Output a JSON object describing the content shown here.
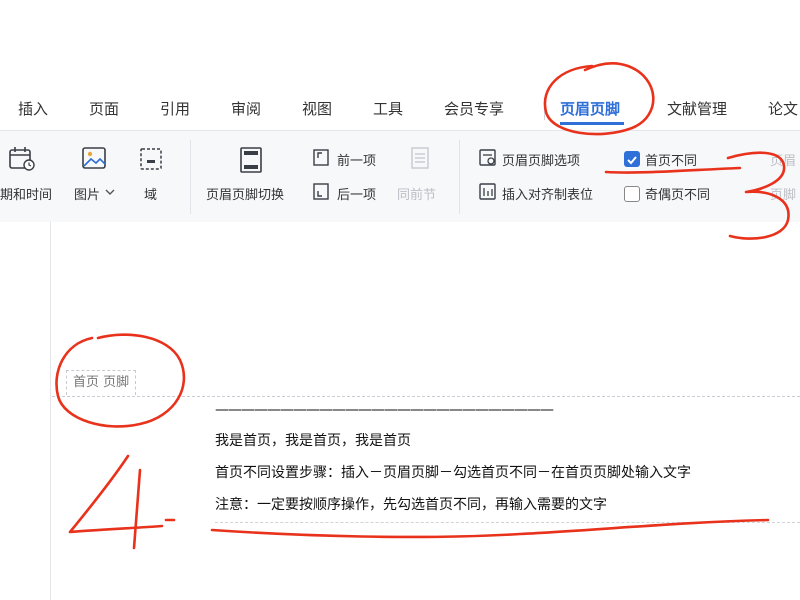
{
  "menu": {
    "items": [
      "插入",
      "页面",
      "引用",
      "审阅",
      "视图",
      "工具",
      "会员专享",
      "页眉页脚",
      "文献管理",
      "论文"
    ],
    "active": "页眉页脚"
  },
  "ribbon": {
    "datetime_label": "期和时间",
    "picture_label": "图片",
    "field_label": "域",
    "switch_label": "页眉页脚切换",
    "prev_label": "前一项",
    "next_label": "后一项",
    "same_prev_label": "同前节",
    "options_label": "页眉页脚选项",
    "insert_tab_label": "插入对齐制表位",
    "first_page_diff_label": "首页不同",
    "first_page_diff_checked": true,
    "odd_even_diff_label": "奇偶页不同",
    "odd_even_diff_checked": false,
    "cut_right_top": "页眉",
    "cut_right_bottom": "页脚"
  },
  "document": {
    "footer_tag": "首页 页脚",
    "rule_line": "——————————————————————————",
    "line1": "我是首页，我是首页，我是首页",
    "line2": "首页不同设置步骤：插入－页眉页脚－勾选首页不同－在首页页脚处输入文字",
    "line3": "注意：一定要按顺序操作，先勾选首页不同，再输入需要的文字"
  },
  "annotations": {
    "number_3": "3",
    "number_4": "4",
    "ink_color": "#e8321c"
  },
  "colors": {
    "accent": "#2f6fd8"
  }
}
